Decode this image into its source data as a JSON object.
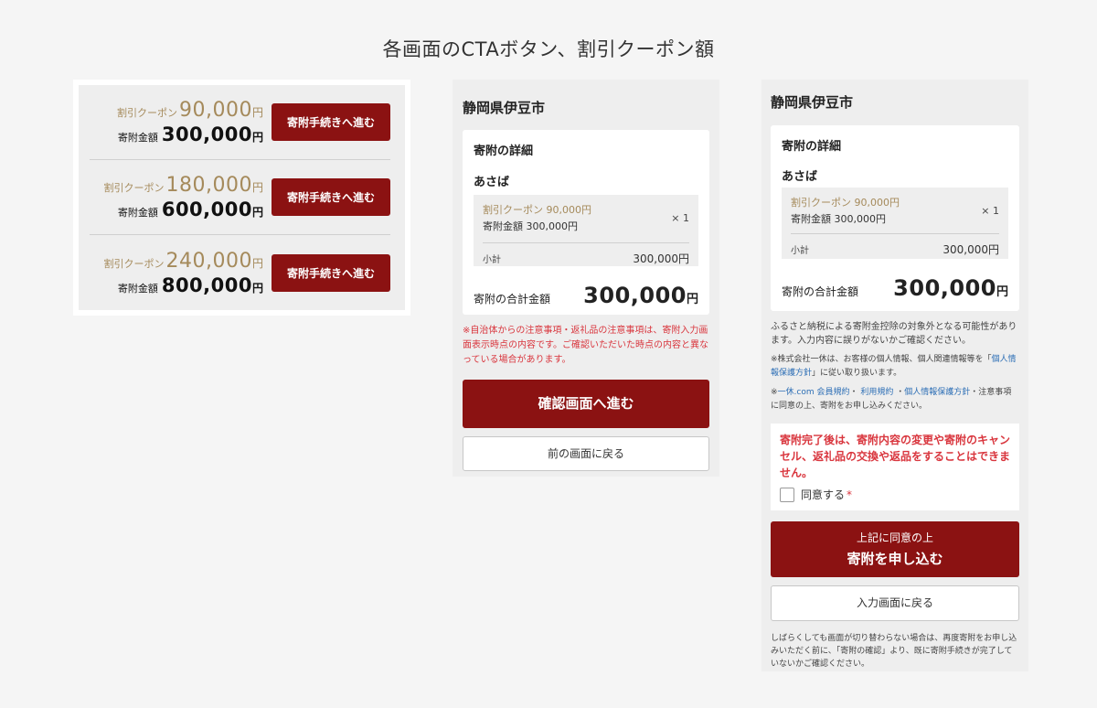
{
  "page": {
    "title": "各画面のCTAボタン、割引クーポン額"
  },
  "cta_list": [
    {
      "coupon_label": "割引クーポン",
      "coupon_amount": "90,000",
      "coupon_unit": "円",
      "donation_label": "寄附金額",
      "donation_amount": "300,000",
      "donation_unit": "円",
      "button_label": "寄附手続きへ進む"
    },
    {
      "coupon_label": "割引クーポン",
      "coupon_amount": "180,000",
      "coupon_unit": "円",
      "donation_label": "寄附金額",
      "donation_amount": "600,000",
      "donation_unit": "円",
      "button_label": "寄附手続きへ進む"
    },
    {
      "coupon_label": "割引クーポン",
      "coupon_amount": "240,000",
      "coupon_unit": "円",
      "donation_label": "寄附金額",
      "donation_amount": "800,000",
      "donation_unit": "円",
      "button_label": "寄附手続きへ進む"
    }
  ],
  "confirm_screen": {
    "city": "静岡県伊豆市",
    "detail_title": "寄附の詳細",
    "item_name": "あさば",
    "item_coupon": "割引クーポン 90,000円",
    "item_amount": "寄附金額 300,000円",
    "item_qty": "× 1",
    "subtotal_label": "小計",
    "subtotal_value": "300,000円",
    "total_label": "寄附の合計金額",
    "total_value": "300,000",
    "total_unit": "円",
    "note": "※自治体からの注意事項・返礼品の注意事項は、寄附入力画面表示時点の内容です。ご確認いただいた時点の内容と異なっている場合があります。",
    "primary_button": "確認画面へ進む",
    "back_button": "前の画面に戻る"
  },
  "submit_screen": {
    "city": "静岡県伊豆市",
    "detail_title": "寄附の詳細",
    "item_name": "あさば",
    "item_coupon": "割引クーポン 90,000円",
    "item_amount": "寄附金額 300,000円",
    "item_qty": "× 1",
    "subtotal_label": "小計",
    "subtotal_value": "300,000円",
    "total_label": "寄附の合計金額",
    "total_value": "300,000",
    "total_unit": "円",
    "note1": "ふるさと納税による寄附金控除の対象外となる可能性があります。入力内容に誤りがないかご確認ください。",
    "note2_prefix": "※株式会社一休は、お客様の個人情報、個人関連情報等を「",
    "note2_link": "個人情報保護方針",
    "note2_suffix": "」に従い取り扱います。",
    "note3_prefix": "※",
    "note3_link1": "一休.com 会員規約",
    "note3_sep1": "・ ",
    "note3_link2": "利用規約",
    "note3_sep2": " ・",
    "note3_link3": "個人情報保護方針",
    "note3_suffix": "・注意事項に同意の上、寄附をお申し込みください。",
    "warning": "寄附完了後は、寄附内容の変更や寄附のキャンセル、返礼品の交換や返品をすることはできません。",
    "agree_label": "同意する",
    "agree_required": "*",
    "primary_button_sub": "上記に同意の上",
    "primary_button_main": "寄附を申し込む",
    "back_button": "入力画面に戻る",
    "bottom_note": "しばらくしても画面が切り替わらない場合は、再度寄附をお申し込みいただく前に、「寄附の確認」より、既に寄附手続きが完了していないかご確認ください。"
  }
}
